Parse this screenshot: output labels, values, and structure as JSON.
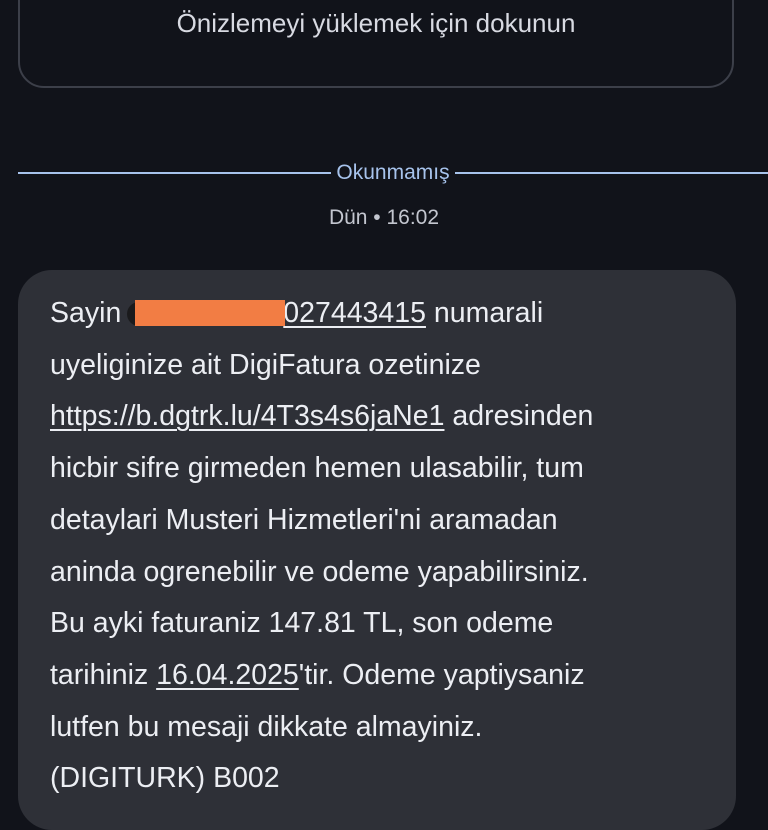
{
  "preview": {
    "text": "Önizlemeyi yüklemek için dokunun"
  },
  "divider": {
    "label": "Okunmamış"
  },
  "timestamp": "Dün • 16:02",
  "message": {
    "greeting": "Sayin",
    "account_number": "027443415",
    "l1_rest": " numarali",
    "l2": "uyeliginize ait DigiFatura ozetinize",
    "url": "https://b.dgtrk.lu/4T3s4s6jaNe1",
    "l3_rest": " adresinden",
    "l4": "hicbir sifre girmeden hemen ulasabilir, tum",
    "l5": "detaylari Musteri Hizmetleri'ni aramadan",
    "l6": "aninda ogrenebilir ve odeme yapabilirsiniz.",
    "l7": "Bu ayki faturaniz 147.81 TL, son odeme",
    "l8_pre": "tarihiniz ",
    "due_date": "16.04.2025",
    "l8_rest": "'tir. Odeme yaptiysaniz",
    "l9": "lutfen bu mesaji dikkate almayiniz.",
    "l10": "(DIGITURK) B002"
  },
  "colors": {
    "background": "#11131a",
    "bubble": "#2e3037",
    "accent_line": "#a7c3ec",
    "redaction_orange": "#f27d44"
  }
}
